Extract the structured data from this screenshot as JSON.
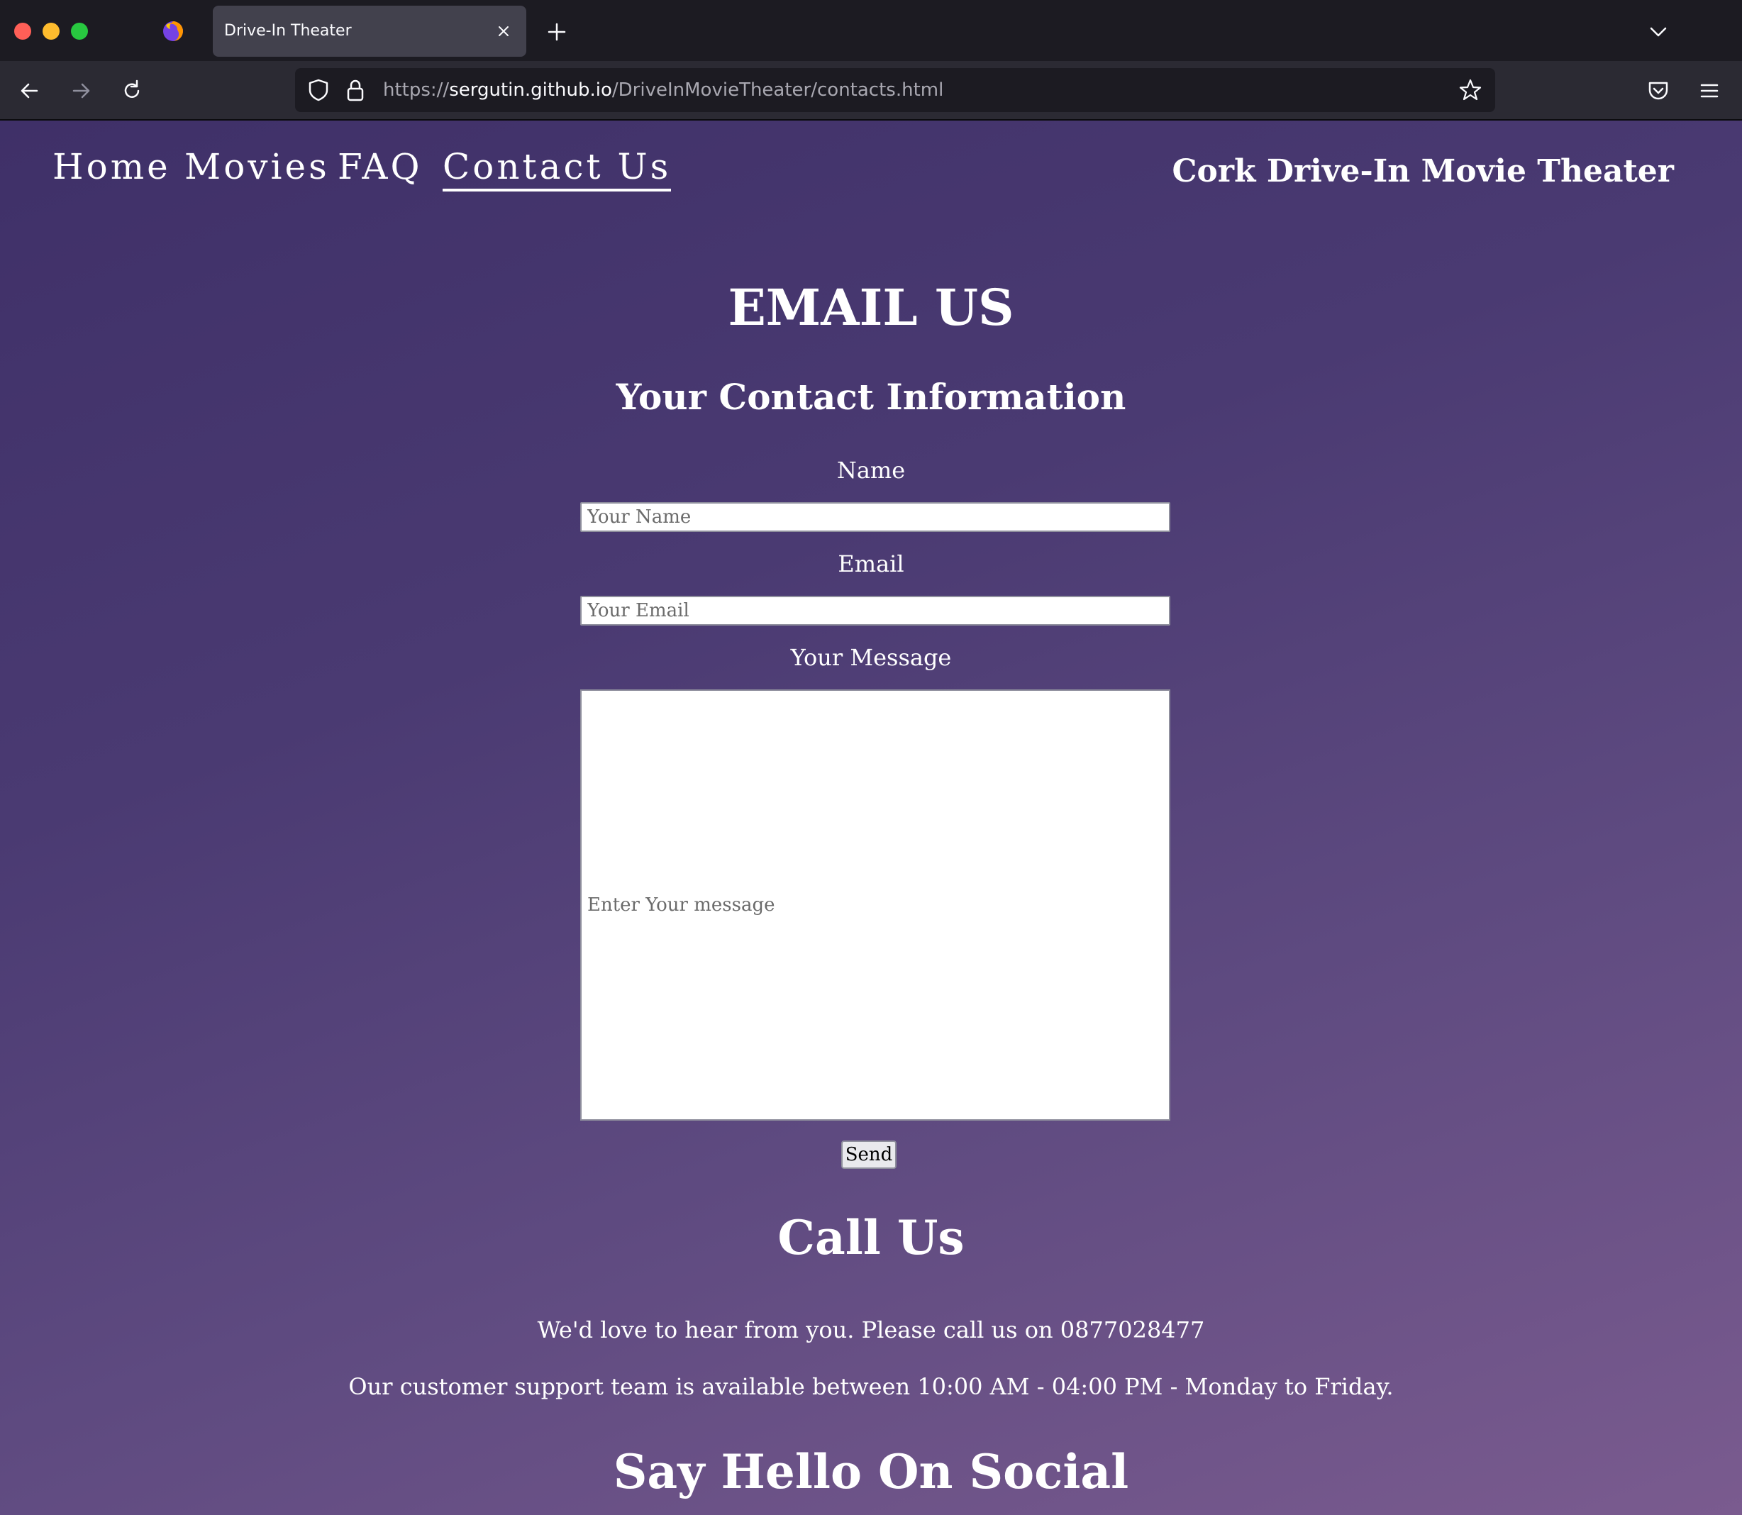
{
  "browser": {
    "tab_title": "Drive-In Theater",
    "url_scheme": "https://",
    "url_host": "sergutin.github.io",
    "url_path": "/DriveInMovieTheater/contacts.html"
  },
  "site_nav": {
    "items": [
      {
        "label": "Home",
        "active": false
      },
      {
        "label": "Movies",
        "active": false
      },
      {
        "label": "FAQ",
        "active": false
      },
      {
        "label": "Contact Us",
        "active": true
      }
    ],
    "brand": "Cork Drive-In Movie Theater"
  },
  "email_section": {
    "title": "EMAIL US",
    "subtitle": "Your Contact Information",
    "name_label": "Name",
    "name_placeholder": "Your Name",
    "email_label": "Email",
    "email_placeholder": "Your Email",
    "message_label": "Your Message",
    "message_placeholder": "Enter Your message",
    "send_label": "Send"
  },
  "call_section": {
    "title": "Call Us",
    "text": "We'd love to hear from you. Please call us on 0877028477",
    "hours": "Our customer support team is available between 10:00 AM - 04:00 PM - Monday to Friday."
  },
  "social_section": {
    "title": "Say Hello On Social"
  },
  "icons": {
    "back": "arrow-left-icon",
    "forward": "arrow-right-icon",
    "reload": "reload-icon",
    "shield": "shield-icon",
    "lock": "lock-icon",
    "star": "star-icon",
    "pocket": "pocket-icon",
    "menu": "hamburger-menu-icon",
    "new_tab": "plus-icon",
    "tab_close": "close-icon",
    "tab_list": "chevron-down-icon",
    "firefox": "firefox-icon"
  },
  "colors": {
    "page_gradient_start": "#3f3068",
    "page_gradient_end": "#7a5b8f",
    "chrome_dark": "#1c1b22",
    "chrome_toolbar": "#2b2a33",
    "tab_active": "#42414d"
  }
}
